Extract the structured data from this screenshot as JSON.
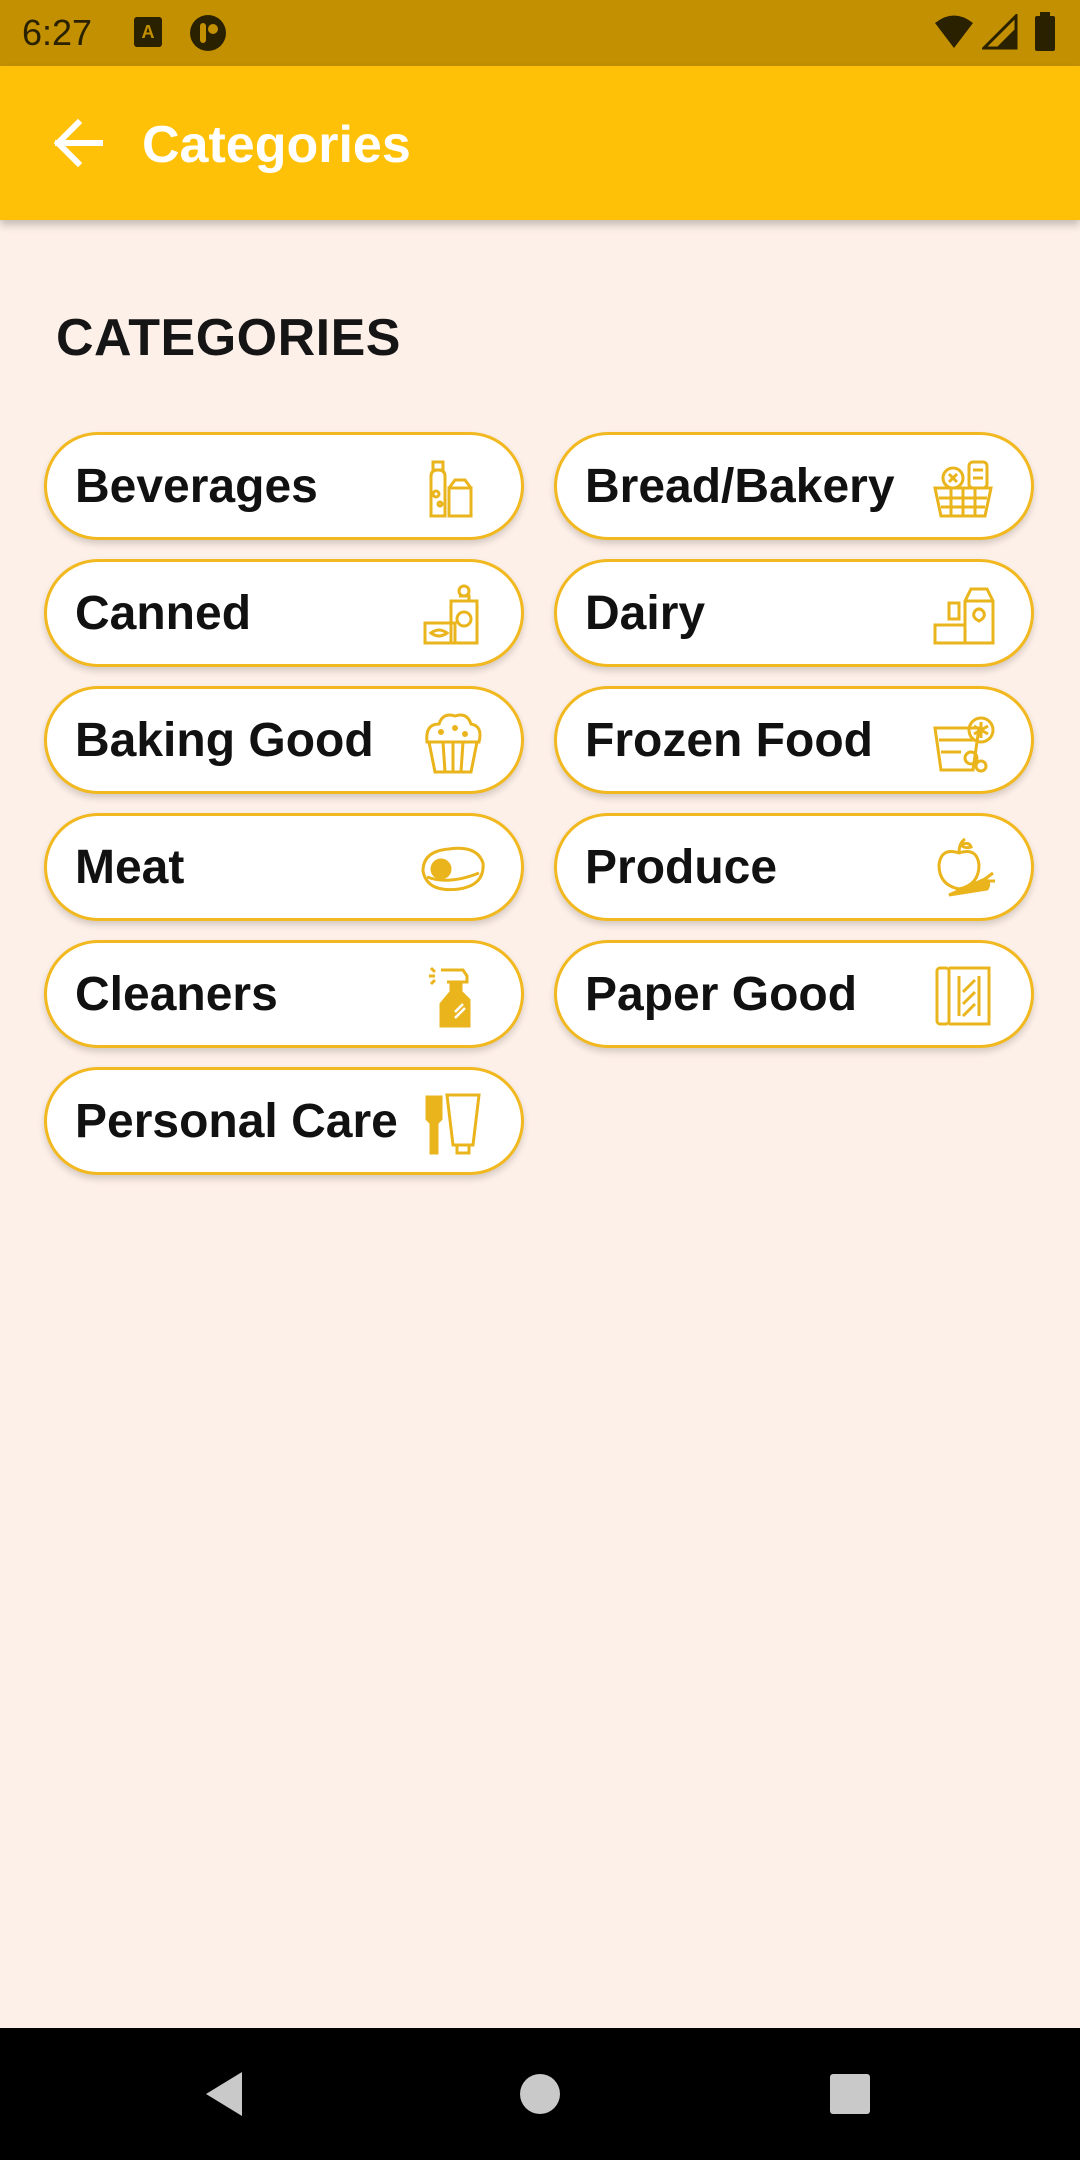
{
  "status_bar": {
    "time": "6:27"
  },
  "app_bar": {
    "title": "Categories"
  },
  "section": {
    "heading": "CATEGORIES"
  },
  "categories": [
    {
      "label": "Beverages",
      "icon": "beverages-icon"
    },
    {
      "label": "Bread/Bakery",
      "icon": "bread-basket-icon"
    },
    {
      "label": "Canned",
      "icon": "canned-food-icon"
    },
    {
      "label": "Dairy",
      "icon": "dairy-icon"
    },
    {
      "label": "Baking Good",
      "icon": "muffin-icon"
    },
    {
      "label": "Frozen Food",
      "icon": "frozen-food-icon"
    },
    {
      "label": "Meat",
      "icon": "steak-icon"
    },
    {
      "label": "Produce",
      "icon": "produce-icon"
    },
    {
      "label": "Cleaners",
      "icon": "spray-bottle-icon"
    },
    {
      "label": "Paper Good",
      "icon": "paper-towel-icon"
    },
    {
      "label": "Personal Care",
      "icon": "toothbrush-tube-icon"
    }
  ],
  "colors": {
    "app_bar": "#ffc107",
    "status_bar": "#c29000",
    "accent": "#f2b81f",
    "background": "#fdf0e8"
  }
}
